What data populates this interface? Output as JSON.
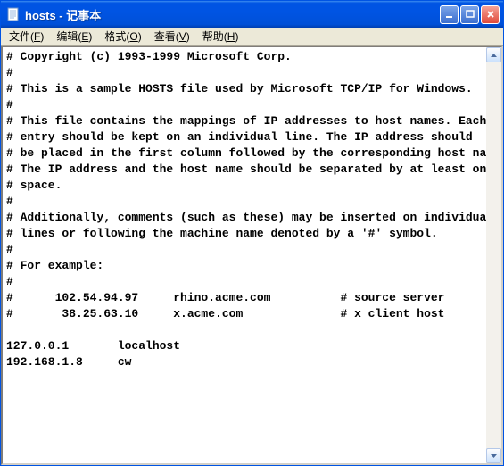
{
  "titlebar": {
    "title": "hosts - 记事本"
  },
  "menus": {
    "file": {
      "label": "文件",
      "hotkey": "F"
    },
    "edit": {
      "label": "编辑",
      "hotkey": "E"
    },
    "format": {
      "label": "格式",
      "hotkey": "O"
    },
    "view": {
      "label": "查看",
      "hotkey": "V"
    },
    "help": {
      "label": "帮助",
      "hotkey": "H"
    }
  },
  "content": "# Copyright (c) 1993-1999 Microsoft Corp.\n#\n# This is a sample HOSTS file used by Microsoft TCP/IP for Windows.\n#\n# This file contains the mappings of IP addresses to host names. Each\n# entry should be kept on an individual line. The IP address should\n# be placed in the first column followed by the corresponding host name.\n# The IP address and the host name should be separated by at least one\n# space.\n#\n# Additionally, comments (such as these) may be inserted on individual\n# lines or following the machine name denoted by a '#' symbol.\n#\n# For example:\n#\n#      102.54.94.97     rhino.acme.com          # source server\n#       38.25.63.10     x.acme.com              # x client host\n\n127.0.0.1       localhost\n192.168.1.8     cw"
}
